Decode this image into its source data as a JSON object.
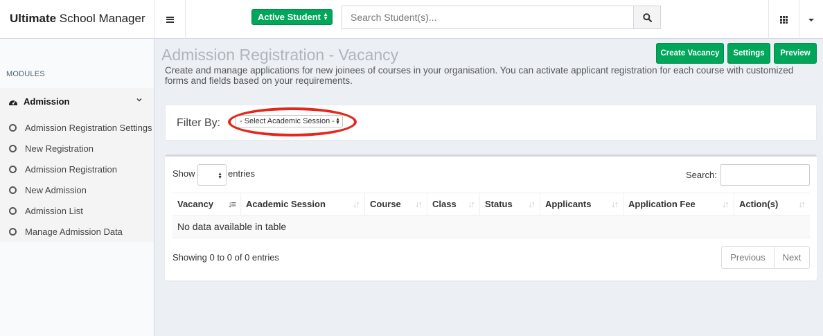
{
  "header": {
    "brand_bold": "Ultimate",
    "brand_rest": " School Manager",
    "student_filter": "Active Student",
    "search_placeholder": "Search Student(s)..."
  },
  "sidebar": {
    "modules_label": "MODULES",
    "section": {
      "label": "Admission",
      "icon": "dashboard-icon",
      "expanded": true
    },
    "items": [
      {
        "label": "Admission Registration Settings"
      },
      {
        "label": "New Registration"
      },
      {
        "label": "Admission Registration"
      },
      {
        "label": "New Admission"
      },
      {
        "label": "Admission List"
      },
      {
        "label": "Manage Admission Data"
      }
    ]
  },
  "page": {
    "title": "Admission Registration - Vacancy",
    "description": "Create and manage applications for new joinees of courses in your organisation. You can activate applicant registration for each course with customized forms and fields based on your requirements.",
    "buttons": {
      "create_vacancy": "Create Vacancy",
      "settings": "Settings",
      "preview": "Preview"
    }
  },
  "filter": {
    "label": "Filter By:",
    "session_select": "- Select Academic Session -"
  },
  "table": {
    "show_label": "Show",
    "entries_label": "entries",
    "search_label": "Search:",
    "columns": [
      {
        "label": "Vacancy",
        "sorted": true
      },
      {
        "label": "Academic Session",
        "sorted": false
      },
      {
        "label": "Course",
        "sorted": false
      },
      {
        "label": "Class",
        "sorted": false
      },
      {
        "label": "Status",
        "sorted": false
      },
      {
        "label": "Applicants",
        "sorted": false
      },
      {
        "label": "Application Fee",
        "sorted": false
      },
      {
        "label": "Action(s)",
        "sorted": false
      }
    ],
    "empty_message": "No data available in table",
    "info": "Showing 0 to 0 of 0 entries",
    "pagination": {
      "previous": "Previous",
      "next": "Next"
    }
  },
  "colors": {
    "accent_green": "#00a65a",
    "highlight_red": "#e5261c",
    "content_bg": "#ecf0f5"
  }
}
